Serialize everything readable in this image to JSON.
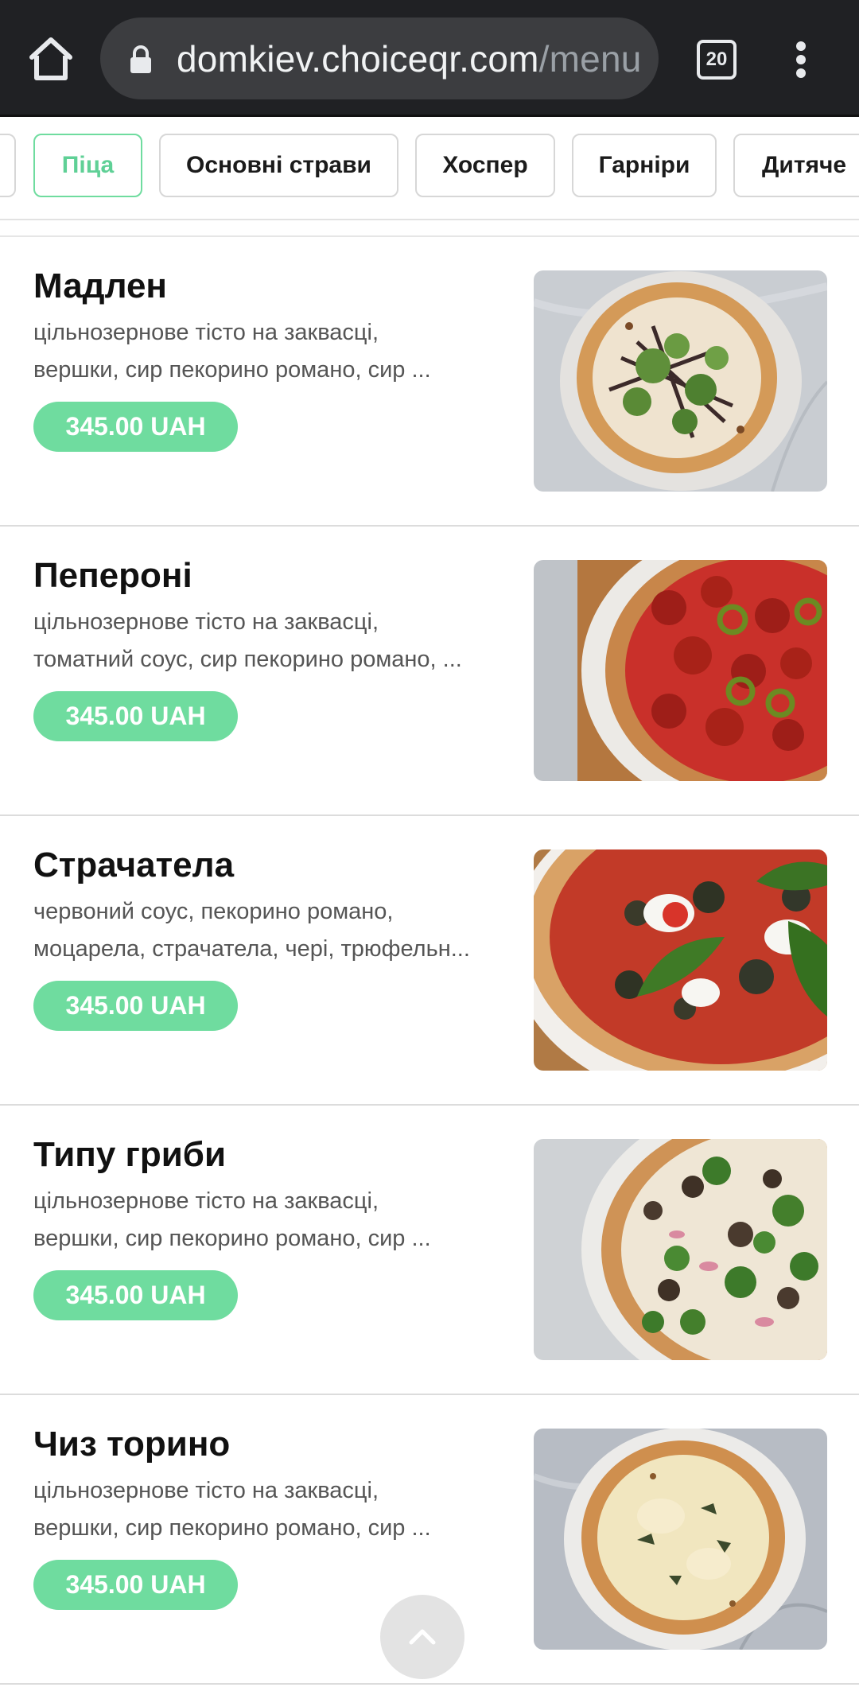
{
  "browser": {
    "url_domain": "domkiev.choiceqr.com",
    "url_path": "/menu",
    "tab_count": "20",
    "icons": [
      "home-icon",
      "lock-icon",
      "tab-switcher-icon",
      "more-vert-icon"
    ]
  },
  "categories": {
    "active": "Піца",
    "items": [
      "Піца",
      "Основні страви",
      "Хоспер",
      "Гарніри",
      "Дитяче"
    ]
  },
  "menu": {
    "currency": "UAH",
    "accent_color": "#6fdc9f",
    "items": [
      {
        "title": "Мадлен",
        "desc1": "цільнозернове тісто на заквасці,",
        "desc2": "вершки, сир пекорино романо, сир ...",
        "price": "345.00 UAH"
      },
      {
        "title": "Пепероні",
        "desc1": "цільнозернове тісто на заквасці,",
        "desc2": "томатний соус, сир пекорино романо, ...",
        "price": "345.00 UAH"
      },
      {
        "title": "Страчатела",
        "desc1": "червоний соус, пекорино романо,",
        "desc2": "моцарела, страчатела, чері, трюфельн...",
        "price": "345.00 UAH"
      },
      {
        "title": "Типу гриби",
        "desc1": "цільнозернове тісто на заквасці,",
        "desc2": "вершки, сир пекорино романо, сир ...",
        "price": "345.00 UAH"
      },
      {
        "title": "Чиз торино",
        "desc1": "цільнозернове тісто на заквасці,",
        "desc2": "вершки, сир пекорино романо, сир ...",
        "price": "345.00 UAH"
      }
    ]
  },
  "scroll_top": {
    "icon": "chevron-up-icon"
  }
}
